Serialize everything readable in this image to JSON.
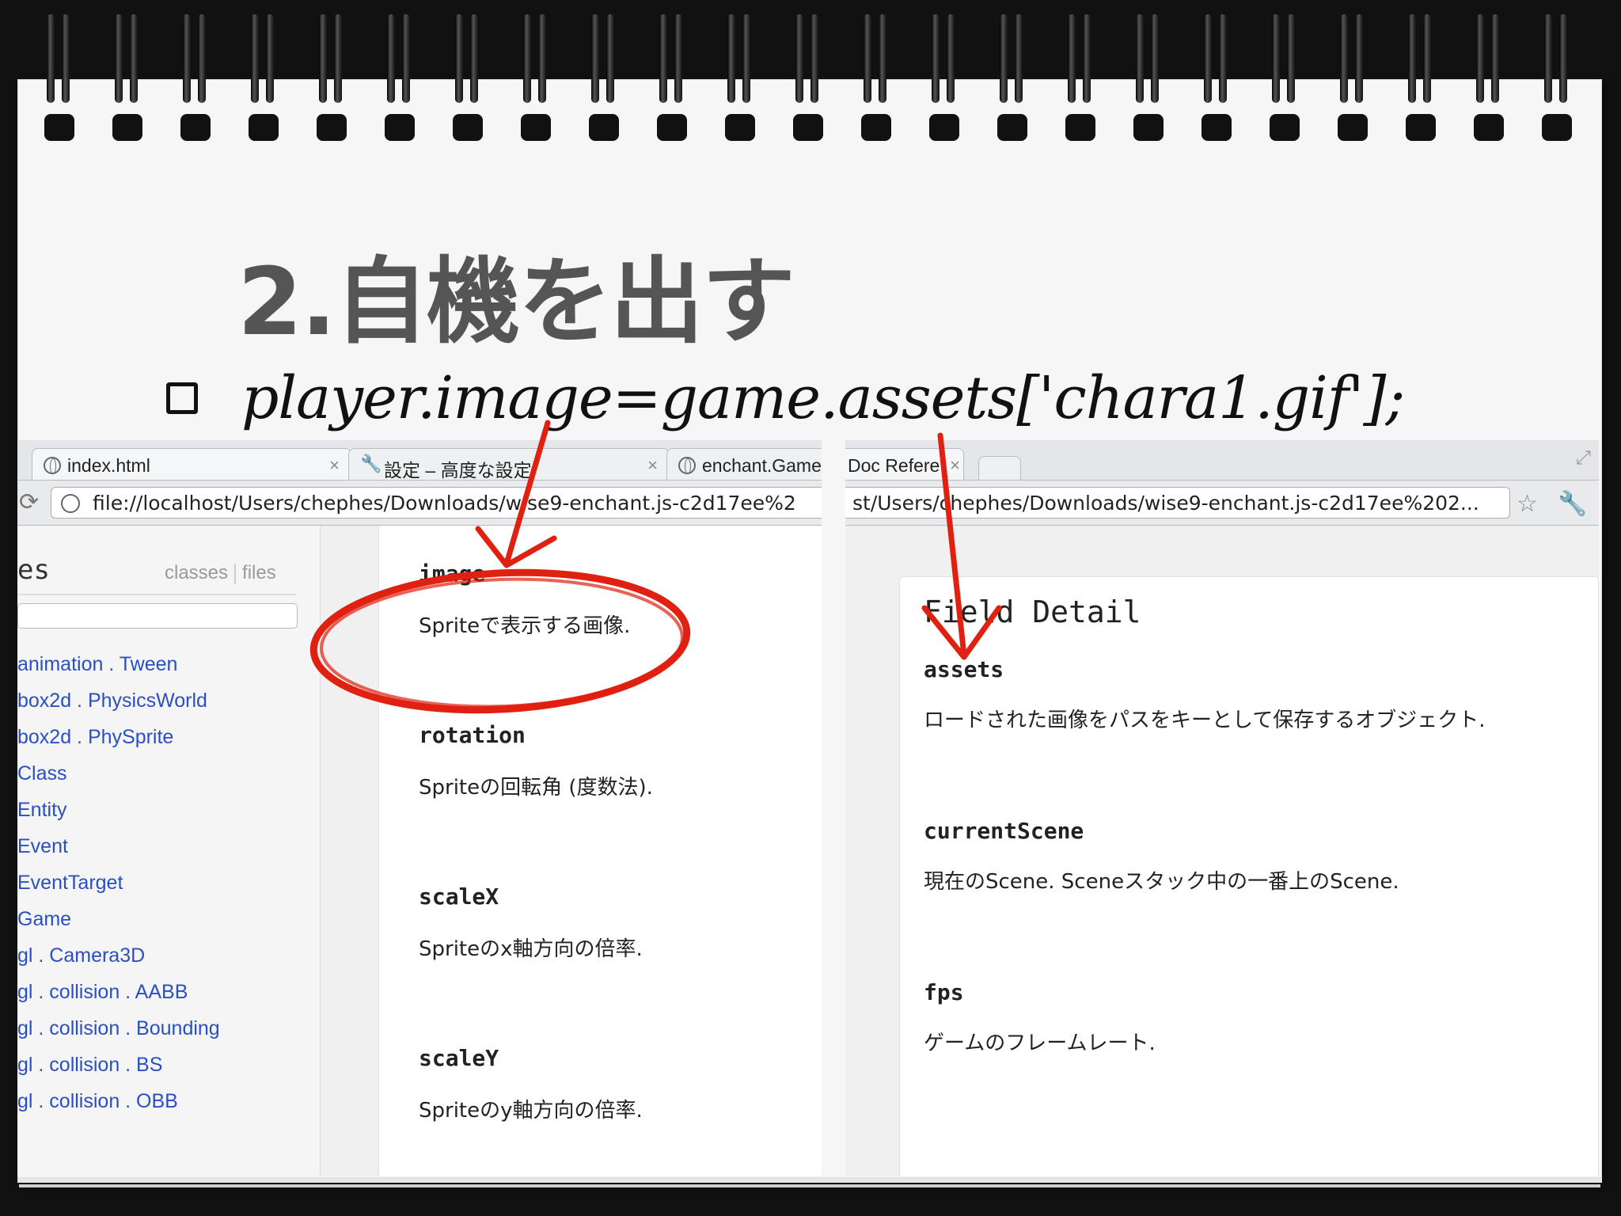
{
  "slide": {
    "title": "2.自機を出す",
    "code": "player.image=game.assets['chara1.gif'];"
  },
  "browser": {
    "tabs": [
      {
        "label": "index.html"
      },
      {
        "label": "設定 – 高度な設定"
      },
      {
        "label": "enchant.Game"
      },
      {
        "label": "Doc Refere"
      }
    ],
    "url_left": "file://localhost/Users/chephes/Downloads/wise9-enchant.js-c2d17ee%2",
    "url_right": "st/Users/chephes/Downloads/wise9-enchant.js-c2d17ee%202...",
    "sidebar": {
      "heading": "es",
      "link_classes": "classes",
      "link_files": "files",
      "items": [
        "animation . Tween",
        "box2d . PhysicsWorld",
        "box2d . PhySprite",
        "Class",
        "Entity",
        "Event",
        "EventTarget",
        "Game",
        "gl . Camera3D",
        "gl . collision . AABB",
        "gl . collision . Bounding",
        "gl . collision . BS",
        "gl . collision . OBB"
      ]
    },
    "sprite_fields": [
      {
        "name": "image",
        "desc": "Spriteで表示する画像."
      },
      {
        "name": "rotation",
        "desc": "Spriteの回転角 (度数法)."
      },
      {
        "name": "scaleX",
        "desc": "Spriteのx軸方向の倍率."
      },
      {
        "name": "scaleY",
        "desc": "Spriteのy軸方向の倍率."
      }
    ],
    "field_detail": {
      "title": "Field Detail",
      "fields": [
        {
          "name": "assets",
          "desc": "ロードされた画像をパスをキーとして保存するオブジェクト."
        },
        {
          "name": "currentScene",
          "desc": "現在のScene. Sceneスタック中の一番上のScene."
        },
        {
          "name": "fps",
          "desc": "ゲームのフレームレート."
        }
      ]
    }
  },
  "colors": {
    "annotation": "#e02010",
    "link": "#2a4fc4",
    "title": "#555555"
  }
}
